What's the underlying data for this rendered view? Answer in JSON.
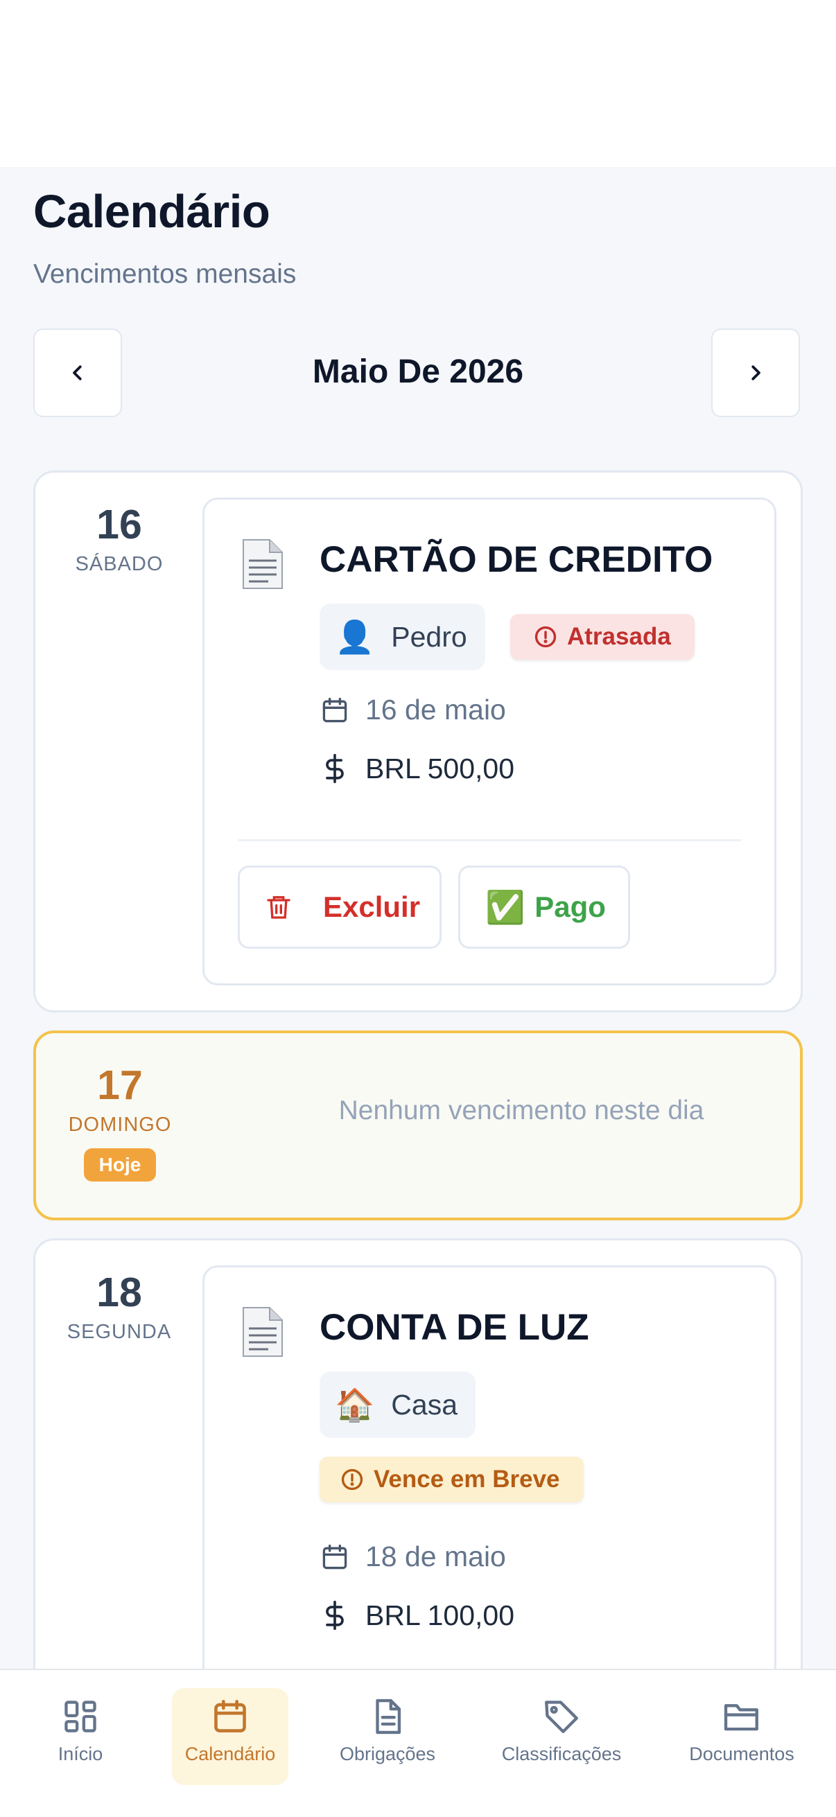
{
  "header": {
    "title": "Calendário",
    "subtitle": "Vencimentos mensais"
  },
  "month_nav": {
    "label": "Maio De 2026",
    "prev_icon": "chevron-left-icon",
    "next_icon": "chevron-right-icon"
  },
  "days": [
    {
      "number": "16",
      "weekday": "SÁBADO",
      "bill": {
        "icon": "document-icon",
        "title": "CARTÃO DE CREDITO",
        "category_emoji": "👤",
        "category": "Pedro",
        "status": "Atrasada",
        "date": "16 de maio",
        "amount": "BRL 500,00",
        "delete_label": "Excluir",
        "paid_emoji": "✅",
        "paid_label": "Pago"
      }
    },
    {
      "number": "17",
      "weekday": "DOMINGO",
      "today_badge": "Hoje",
      "empty_message": "Nenhum vencimento neste dia"
    },
    {
      "number": "18",
      "weekday": "SEGUNDA",
      "bill": {
        "icon": "document-icon",
        "title": "CONTA DE LUZ",
        "category_emoji": "🏠",
        "category": "Casa",
        "status": "Vence em Breve",
        "date": "18 de maio",
        "amount": "BRL 100,00"
      }
    }
  ],
  "bottom_nav": {
    "tabs": [
      {
        "label": "Início",
        "icon": "grid-icon",
        "active": false
      },
      {
        "label": "Calendário",
        "icon": "calendar-icon",
        "active": true
      },
      {
        "label": "Obrigações",
        "icon": "document-icon",
        "active": false
      },
      {
        "label": "Classificações",
        "icon": "tag-icon",
        "active": false
      },
      {
        "label": "Documentos",
        "icon": "folder-icon",
        "active": false
      }
    ]
  },
  "colors": {
    "accent": "#c2772d",
    "danger": "#d42f2a",
    "success": "#3da34a",
    "warning_bg": "#fdf0cf",
    "today_border": "#f4c24b"
  }
}
